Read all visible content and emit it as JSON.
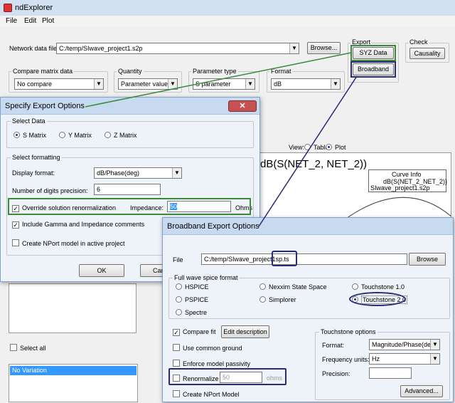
{
  "app": {
    "title": "ndExplorer",
    "menu": [
      "File",
      "Edit",
      "Plot"
    ]
  },
  "main": {
    "network_file_label": "Network data file:",
    "network_file_value": "C:/temp/SIwave_project1.s2p",
    "browse_label": "Browse...",
    "export_group": "Export",
    "syz_data_label": "SYZ Data",
    "broadband_label": "Broadband",
    "check_label": "Check",
    "causality_label": "Causality",
    "compare_group": "Compare matrix data",
    "compare_value": "No compare",
    "quantity_group": "Quantity",
    "quantity_value": "Parameter values",
    "param_type_group": "Parameter type",
    "param_type_value": "S parameter",
    "format_group": "Format",
    "format_value": "dB",
    "view_label": "View:",
    "view_table": "Table",
    "view_plot": "Plot",
    "plot_title": "dB(S(NET_2, NET_2))",
    "curve_info_title": "Curve Info",
    "curve_info_line1": "dB(S(NET_2_NET_2))",
    "curve_info_line2": "SIwave_project1.s2p",
    "select_all_label": "Select all",
    "list_selected": "No Variation"
  },
  "specify_dialog": {
    "title": "Specify Export Options",
    "select_data_group": "Select Data",
    "radio_s": "S Matrix",
    "radio_y": "Y Matrix",
    "radio_z": "Z Matrix",
    "select_formatting_group": "Select formatting",
    "display_format_label": "Display format:",
    "display_format_value": "dB/Phase(deg)",
    "digits_label": "Number of digits precision:",
    "digits_value": "6",
    "override_label": "Override solution renormalization",
    "impedance_label": "Impedance:",
    "impedance_value": "50",
    "ohms_label": "Ohms",
    "gamma_label": "Include Gamma and Impedance comments",
    "nport_label": "Create NPort model in active project",
    "ok_label": "OK",
    "cancel_label": "Cancel"
  },
  "broadband_dialog": {
    "title": "Broadband Export Options",
    "file_label": "File",
    "file_value": "C:/temp/SIwave_project1",
    "file_ext": "sp.ts",
    "browse_label": "Browse",
    "spice_group": "Full wave spice format",
    "radio_hspice": "HSPICE",
    "radio_pspice": "PSPICE",
    "radio_spectre": "Spectre",
    "radio_nexxim": "Nexxim State Space",
    "radio_simplorer": "Simplorer",
    "radio_ts1": "Touchstone 1.0",
    "radio_ts2": "Touchstone 2.0",
    "compare_fit_label": "Compare fit",
    "edit_desc_label": "Edit description",
    "common_ground_label": "Use common ground",
    "passivity_label": "Enforce model passivity",
    "renormalize_label": "Renormalize",
    "renormalize_value": "50",
    "renormalize_unit": "ohms",
    "nport_label": "Create NPort Model",
    "ts_options_group": "Touchstone options",
    "ts_format_label": "Format:",
    "ts_format_value": "Magnitude/Phase(deg)",
    "freq_units_label": "Frequency units:",
    "freq_units_value": "Hz",
    "precision_label": "Precision:",
    "advanced_label": "Advanced..."
  },
  "colors": {
    "highlight_green": "#3a8a3a",
    "highlight_navy": "#2a2a7a",
    "dialog_bg": "#eef3f9",
    "title_bar": "#c8daf0",
    "selected_list": "#3399ff"
  }
}
